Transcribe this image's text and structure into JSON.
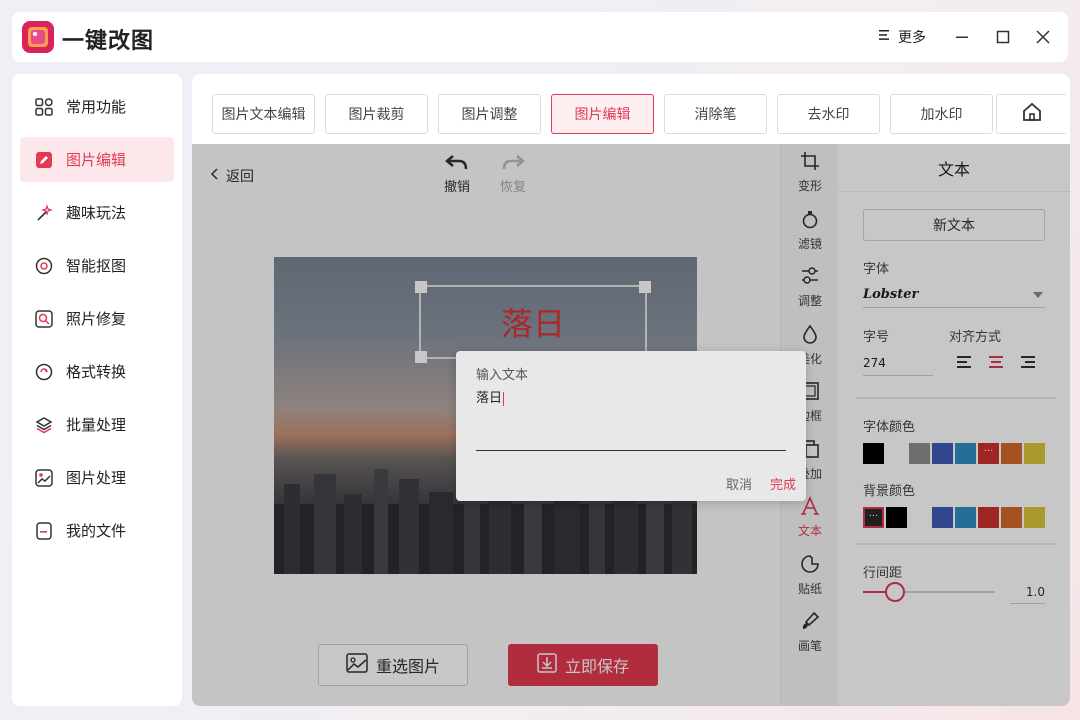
{
  "app": {
    "title": "一键改图"
  },
  "titlebar": {
    "more_label": "更多"
  },
  "sidebar": {
    "items": [
      {
        "label": "常用功能"
      },
      {
        "label": "图片编辑"
      },
      {
        "label": "趣味玩法"
      },
      {
        "label": "智能抠图"
      },
      {
        "label": "照片修复"
      },
      {
        "label": "格式转换"
      },
      {
        "label": "批量处理"
      },
      {
        "label": "图片处理"
      },
      {
        "label": "我的文件"
      }
    ]
  },
  "tabs": [
    {
      "label": "图片文本编辑"
    },
    {
      "label": "图片裁剪"
    },
    {
      "label": "图片调整"
    },
    {
      "label": "图片编辑"
    },
    {
      "label": "消除笔"
    },
    {
      "label": "去水印"
    },
    {
      "label": "加水印"
    }
  ],
  "editor": {
    "back_label": "返回",
    "undo_label": "撤销",
    "redo_label": "恢复",
    "canvas_text": "落日",
    "reselect_label": "重选图片",
    "save_label": "立即保存"
  },
  "tools": [
    {
      "label": "变形",
      "icon": "crop-icon"
    },
    {
      "label": "滤镜",
      "icon": "filter-icon"
    },
    {
      "label": "调整",
      "icon": "adjust-icon"
    },
    {
      "label": "美化",
      "icon": "drop-icon"
    },
    {
      "label": "边框",
      "icon": "frame-icon"
    },
    {
      "label": "叠加",
      "icon": "overlay-icon"
    },
    {
      "label": "文本",
      "icon": "text-icon"
    },
    {
      "label": "贴纸",
      "icon": "sticker-icon"
    },
    {
      "label": "画笔",
      "icon": "brush-icon"
    }
  ],
  "props": {
    "title": "文本",
    "new_text_label": "新文本",
    "font_label": "字体",
    "font_value": "Lobster",
    "size_label": "字号",
    "size_value": "274",
    "align_label": "对齐方式",
    "font_color_label": "字体颜色",
    "bg_color_label": "背景颜色",
    "line_spacing_label": "行间距",
    "line_spacing_value": "1.0",
    "font_colors": [
      "#000000",
      "#ffffff",
      "#8e8e8e",
      "#3e5ab5",
      "#2f8fc2",
      "#c9302c",
      "#d4692c",
      "#d9c53a"
    ],
    "bg_colors": [
      "#2a2a2a",
      "#000000",
      "#ffffff",
      "#3e5ab5",
      "#2f8fc2",
      "#c9302c",
      "#d4692c",
      "#d9c53a"
    ]
  },
  "dialog": {
    "label": "输入文本",
    "value": "落日",
    "cancel_label": "取消",
    "done_label": "完成"
  },
  "colors": {
    "accent": "#e03a55"
  }
}
